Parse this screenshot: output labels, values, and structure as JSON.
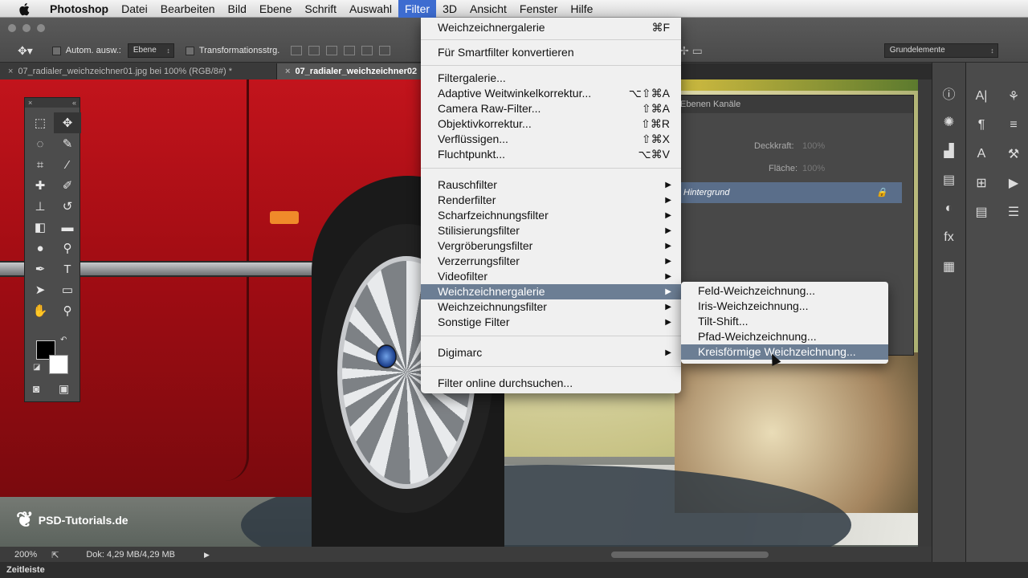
{
  "menubar": {
    "app": "Photoshop",
    "items": [
      "Datei",
      "Bearbeiten",
      "Bild",
      "Ebene",
      "Schrift",
      "Auswahl",
      "Filter",
      "3D",
      "Ansicht",
      "Fenster",
      "Hilfe"
    ],
    "active": "Filter"
  },
  "options": {
    "auto_select_label": "Autom. ausw.:",
    "auto_select_value": "Ebene",
    "transform_label": "Transformationsstrg.",
    "workspace": "Grundelemente"
  },
  "tabs": [
    {
      "label": "07_radialer_weichzeichner01.jpg bei 100% (RGB/8#) *"
    },
    {
      "label": "07_radialer_weichzeichner02"
    }
  ],
  "layers_panel": {
    "tabs": "Ebenen   Kanäle",
    "opacity_label": "Deckkraft:",
    "opacity_value": "100%",
    "fill_label": "Fläche:",
    "fill_value": "100%",
    "layer_name": "Hintergrund"
  },
  "filter_menu": {
    "items": [
      {
        "label": "Weichzeichnergalerie",
        "shortcut": "⌘F"
      },
      {
        "label": "Für Smartfilter konvertieren"
      },
      {
        "label": "Filtergalerie..."
      },
      {
        "label": "Adaptive Weitwinkelkorrektur...",
        "shortcut": "⌥⇧⌘A"
      },
      {
        "label": "Camera Raw-Filter...",
        "shortcut": "⇧⌘A"
      },
      {
        "label": "Objektivkorrektur...",
        "shortcut": "⇧⌘R"
      },
      {
        "label": "Verflüssigen...",
        "shortcut": "⇧⌘X"
      },
      {
        "label": "Fluchtpunkt...",
        "shortcut": "⌥⌘V"
      },
      {
        "label": "Rauschfilter"
      },
      {
        "label": "Renderfilter"
      },
      {
        "label": "Scharfzeichnungsfilter"
      },
      {
        "label": "Stilisierungsfilter"
      },
      {
        "label": "Vergröberungsfilter"
      },
      {
        "label": "Verzerrungsfilter"
      },
      {
        "label": "Videofilter"
      },
      {
        "label": "Weichzeichnergalerie"
      },
      {
        "label": "Weichzeichnungsfilter"
      },
      {
        "label": "Sonstige Filter"
      },
      {
        "label": "Digimarc"
      },
      {
        "label": "Filter online durchsuchen..."
      }
    ]
  },
  "submenu": {
    "items": [
      "Feld-Weichzeichnung...",
      "Iris-Weichzeichnung...",
      "Tilt-Shift...",
      "Pfad-Weichzeichnung...",
      "Kreisförmige Weichzeichnung..."
    ],
    "highlighted": "Kreisförmige Weichzeichnung..."
  },
  "status": {
    "zoom": "200%",
    "doc": "Dok: 4,29 MB/4,29 MB"
  },
  "timeline": "Zeitleiste",
  "watermark": "PSD-Tutorials.de"
}
